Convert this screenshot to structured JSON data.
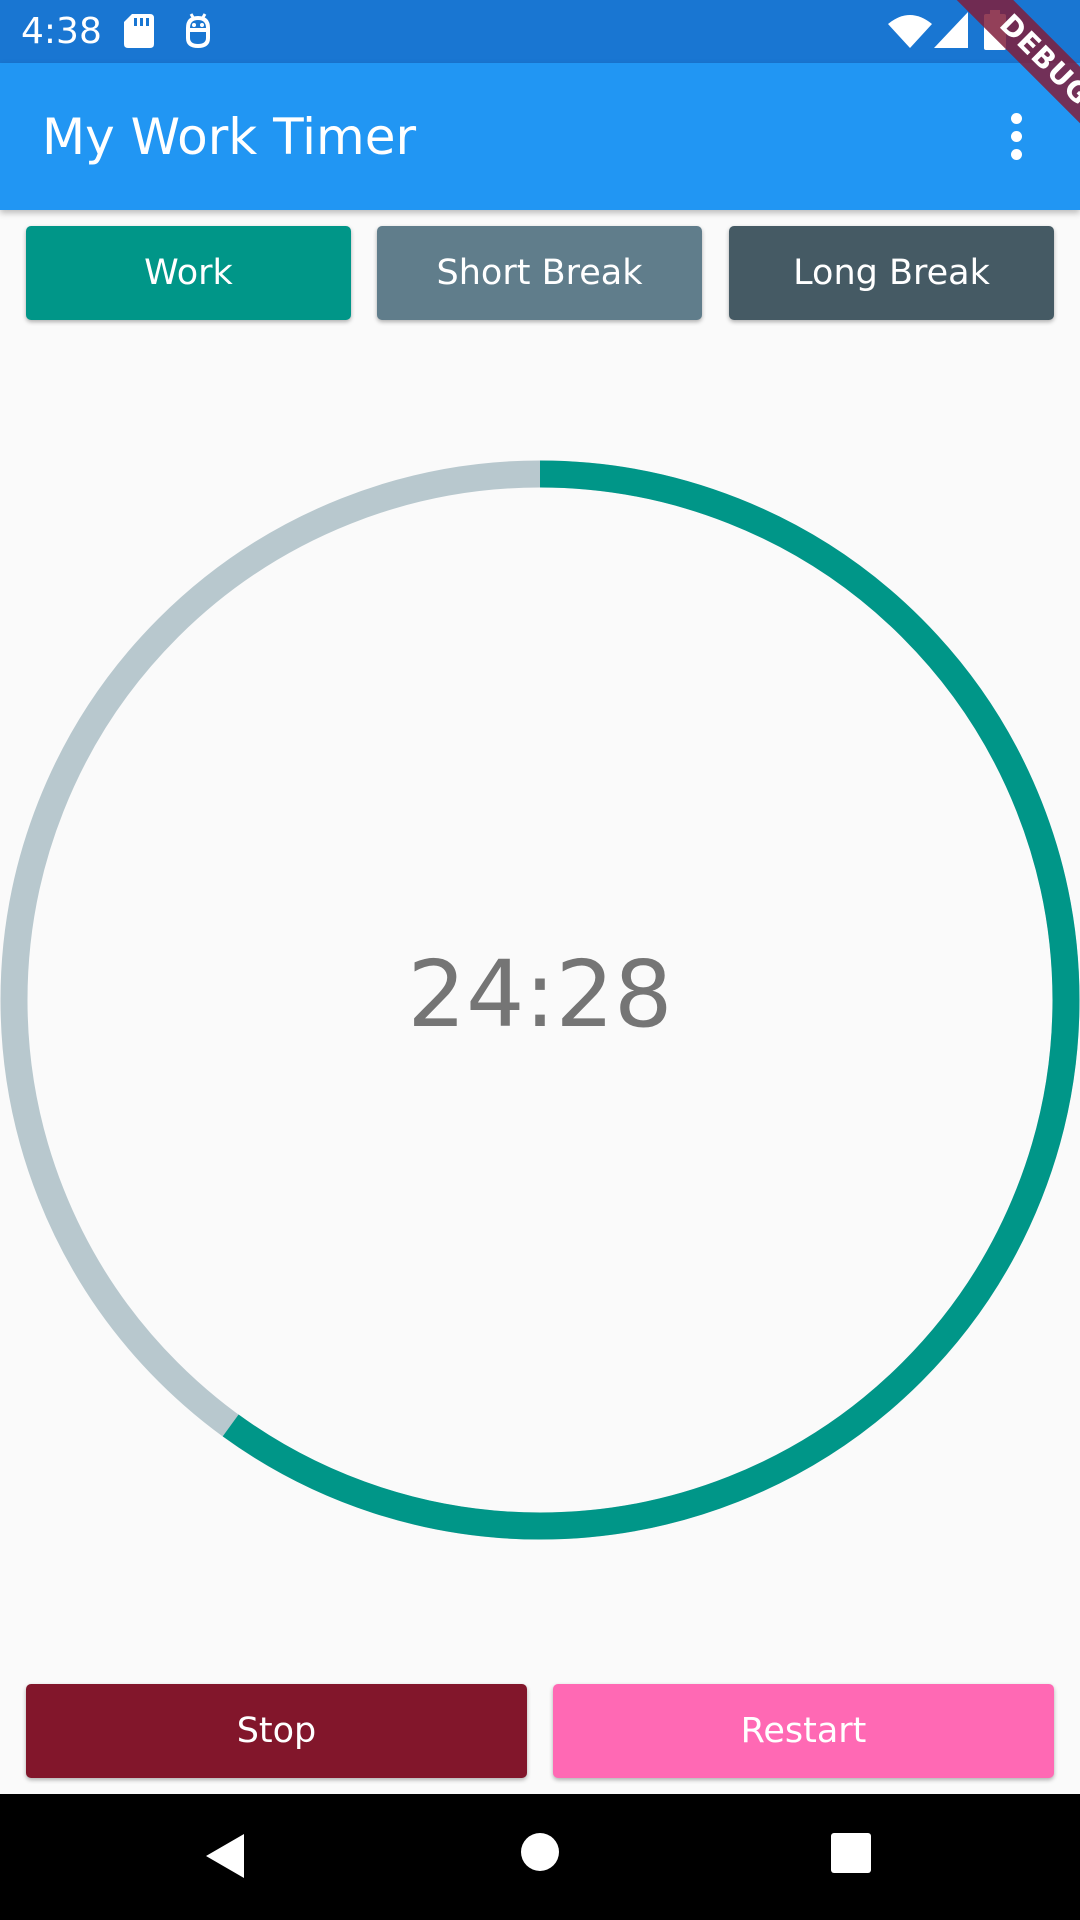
{
  "status_bar": {
    "time": "4:38",
    "icons": [
      "sd-card-icon",
      "android-debug-icon",
      "wifi-icon",
      "signal-icon",
      "battery-icon"
    ]
  },
  "debug_banner": {
    "label": "DEBUG"
  },
  "app_bar": {
    "title": "My Work Timer",
    "menu_icon": "more-vert-icon"
  },
  "mode_buttons": [
    {
      "label": "Work",
      "color": "#009688"
    },
    {
      "label": "Short Break",
      "color": "#607d8b"
    },
    {
      "label": "Long Break",
      "color": "#455a64"
    }
  ],
  "timer": {
    "time": "24:28",
    "progress": 0.6,
    "progress_color": "#009688",
    "track_color": "#b8c8ce",
    "text_color": "#757575"
  },
  "action_buttons": [
    {
      "label": "Stop",
      "color": "#82162b"
    },
    {
      "label": "Restart",
      "color": "#ff69b4"
    }
  ],
  "nav_bar": {
    "icons": [
      "back-icon",
      "home-icon",
      "recents-icon"
    ]
  }
}
